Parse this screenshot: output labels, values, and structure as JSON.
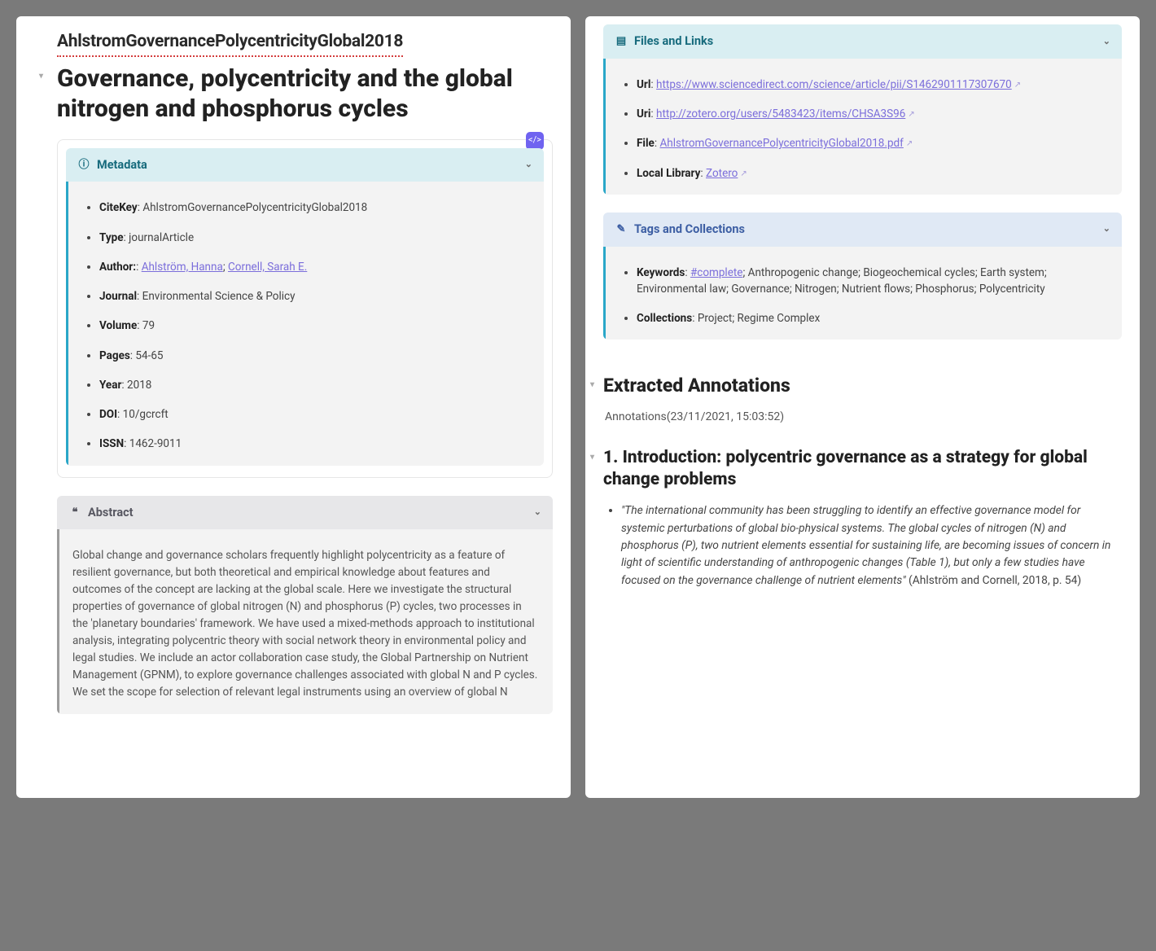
{
  "filename": "AhlstromGovernancePolycentricityGlobal2018",
  "title": "Governance, polycentricity and the global nitrogen and phosphorus cycles",
  "metadata": {
    "header": "Metadata",
    "items": {
      "citekey_l": "CiteKey",
      "citekey_v": "AhlstromGovernancePolycentricityGlobal2018",
      "type_l": "Type",
      "type_v": "journalArticle",
      "author_l": "Author:",
      "author1": "Ahlström, Hanna",
      "author2": "Cornell, Sarah E.",
      "journal_l": "Journal",
      "journal_v": "Environmental Science & Policy",
      "volume_l": "Volume",
      "volume_v": "79",
      "pages_l": "Pages",
      "pages_v": "54-65",
      "year_l": "Year",
      "year_v": "2018",
      "doi_l": "DOI",
      "doi_v": "10/gcrcft",
      "issn_l": "ISSN",
      "issn_v": "1462-9011"
    }
  },
  "abstract": {
    "header": "Abstract",
    "text": "Global change and governance scholars frequently highlight polycentricity as a feature of resilient governance, but both theoretical and empirical knowledge about features and outcomes of the concept are lacking at the global scale. Here we investigate the structural properties of governance of global nitrogen (N) and phosphorus (P) cycles, two processes in the 'planetary boundaries' framework. We have used a mixed-methods approach to institutional analysis, integrating polycentric theory with social network theory in environmental policy and legal studies. We include an actor collaboration case study, the Global Partnership on Nutrient Management (GPNM), to explore governance challenges associated with global N and P cycles. We set the scope for selection of relevant legal instruments using an overview of global N"
  },
  "files": {
    "header": "Files and Links",
    "url_l": "Url",
    "url_v": "https://www.sciencedirect.com/science/article/pii/S1462901117307670",
    "uri_l": "Uri",
    "uri_v": "http://zotero.org/users/5483423/items/CHSA3S96",
    "file_l": "File",
    "file_v": "AhlstromGovernancePolycentricityGlobal2018.pdf",
    "local_l": "Local Library",
    "local_v": "Zotero"
  },
  "tags": {
    "header": "Tags and Collections",
    "kw_l": "Keywords",
    "kw_link": "#complete",
    "kw_rest": "; Anthropogenic change; Biogeochemical cycles; Earth system; Environmental law; Governance; Nitrogen; Nutrient flows; Phosphorus; Polycentricity",
    "coll_l": "Collections",
    "coll_v": "Project; Regime Complex"
  },
  "annotations": {
    "section": "Extracted Annotations",
    "timestamp": "Annotations(23/11/2021, 15:03:52)",
    "h3": "1. Introduction: polycentric governance as a strategy for global change problems",
    "quote": "\"The international community has been struggling to identify an effective governance model for systemic perturbations of global bio-physical systems. The global cycles of nitrogen (N) and phosphorus (P), two nutrient elements essential for sustaining life, are becoming issues of concern in light of scientific understanding of anthropogenic changes (Table 1), but only a few studies have focused on the governance challenge of nutrient elements\"",
    "cite": " (Ahlström and Cornell, 2018, p. 54)"
  }
}
